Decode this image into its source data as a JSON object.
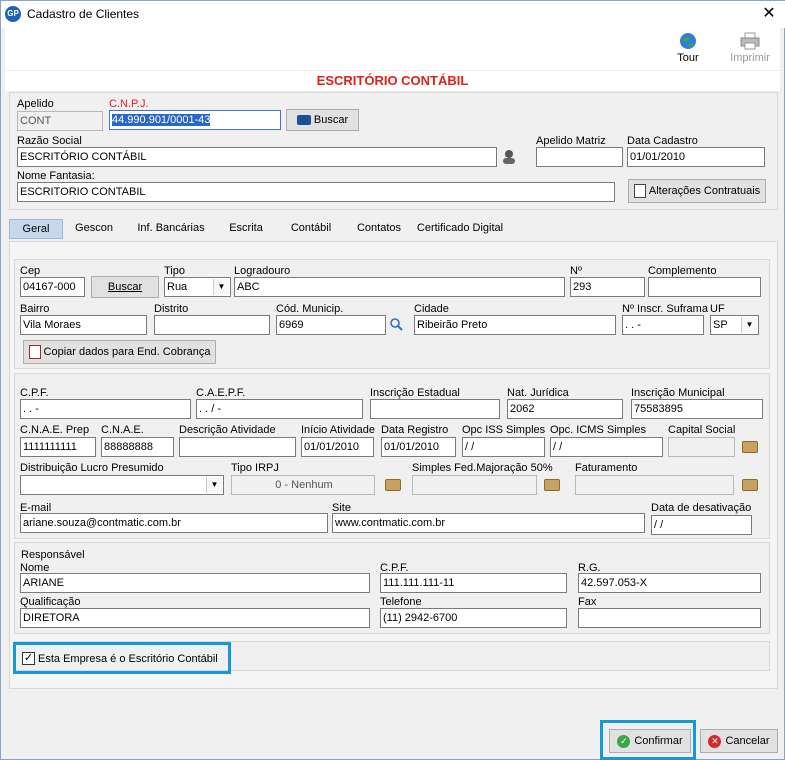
{
  "window": {
    "title": "Cadastro de Clientes",
    "app_icon": "GP",
    "close": "✕"
  },
  "toolbar": {
    "tour": "Tour",
    "imprimir": "Imprimir"
  },
  "header": {
    "title": "ESCRITÓRIO CONTÁBIL"
  },
  "top": {
    "apelido_label": "Apelido",
    "apelido": "CONT",
    "cnpj_label": "C.N.P.J.",
    "cnpj": "44.990.901/0001-43",
    "buscar": "Buscar",
    "razao_label": "Razão Social",
    "razao": "ESCRITÓRIO CONTÁBIL",
    "apelido_matriz_label": "Apelido Matriz",
    "apelido_matriz": "",
    "data_cadastro_label": "Data Cadastro",
    "data_cadastro": "01/01/2010",
    "fantasia_label": "Nome Fantasia:",
    "fantasia": "ESCRITORIO CONTABIL",
    "alteracoes": "Alterações Contratuais"
  },
  "tabs": [
    "Geral",
    "Gescon",
    "Inf. Bancárias",
    "Escrita",
    "Contábil",
    "Contatos",
    "Certificado Digital"
  ],
  "endereco": {
    "cep_label": "Cep",
    "cep": "04167-000",
    "buscar": "Buscar",
    "tipo_label": "Tipo",
    "tipo": "Rua",
    "logradouro_label": "Logradouro",
    "logradouro": "ABC",
    "numero_label": "Nº",
    "numero": "293",
    "complemento_label": "Complemento",
    "complemento": "",
    "bairro_label": "Bairro",
    "bairro": "Vila Moraes",
    "distrito_label": "Distrito",
    "distrito": "",
    "cod_municip_label": "Cód. Municip.",
    "cod_municip": "6969",
    "cidade_label": "Cidade",
    "cidade": "Ribeirão Preto",
    "suframa_label": "Nº Inscr. Suframa",
    "suframa": " .   .   -",
    "uf_label": "UF",
    "uf": "SP",
    "copiar": "Copiar dados para End. Cobrança"
  },
  "fiscal": {
    "cpf_label": "C.P.F.",
    "cpf": "  .    .    -",
    "caepf_label": "C.A.E.P.F.",
    "caepf": "  .    .   /   -",
    "ie_label": "Inscrição Estadual",
    "ie": "",
    "nat_label": "Nat. Jurídica",
    "nat": "2062",
    "im_label": "Inscrição Municipal",
    "im": "75583895",
    "cnae_prep_label": "C.N.A.E. Prep",
    "cnae_prep": "1111111111",
    "cnae_label": "C.N.A.E.",
    "cnae": "88888888",
    "desc_label": "Descrição Atividade",
    "desc": "",
    "inicio_label": "Início Atividade",
    "inicio": "01/01/2010",
    "registro_label": "Data Registro",
    "registro": "01/01/2010",
    "iss_label": "Opc ISS Simples",
    "iss": " /  /",
    "icms_label": "Opc. ICMS Simples",
    "icms": " /  /",
    "capital_label": "Capital Social",
    "capital": "",
    "dist_label": "Distribuição Lucro Presumido",
    "dist": "",
    "irpj_label": "Tipo IRPJ",
    "irpj": "0 - Nenhum",
    "simples_label": "Simples Fed.Majoração 50%",
    "simples": "",
    "fat_label": "Faturamento",
    "fat": "",
    "email_label": "E-mail",
    "email": "ariane.souza@contmatic.com.br",
    "site_label": "Site",
    "site": "www.contmatic.com.br",
    "desativ_label": "Data de desativação",
    "desativ": " /  /"
  },
  "responsavel": {
    "group": "Responsável",
    "nome_label": "Nome",
    "nome": "ARIANE",
    "cpf_label": "C.P.F.",
    "cpf": "111.111.111-11",
    "rg_label": "R.G.",
    "rg": "42.597.053-X",
    "qual_label": "Qualificação",
    "qual": "DIRETORA",
    "tel_label": "Telefone",
    "tel": "(11) 2942-6700",
    "fax_label": "Fax",
    "fax": ""
  },
  "escritorio_check": {
    "label": "Esta Empresa é o Escritório Contábil",
    "checked": "✓"
  },
  "footer": {
    "confirmar": "Confirmar",
    "cancelar": "Cancelar"
  },
  "colors": {
    "header_red": "#e0201a",
    "highlight": "#1799d8",
    "tab_active": "#c8d8ec"
  }
}
